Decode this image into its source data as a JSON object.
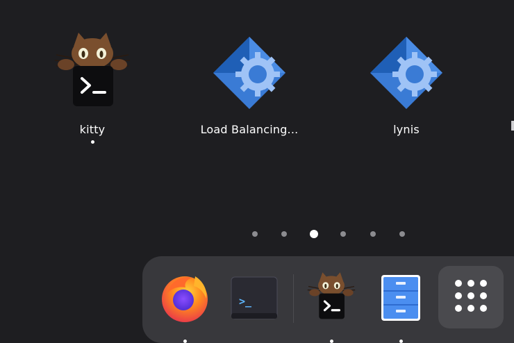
{
  "grid": {
    "apps": [
      {
        "label": "kitty",
        "icon": "kitty-cat-terminal-icon",
        "running": true
      },
      {
        "label": "Load Balancing...",
        "icon": "gear-diamond-icon",
        "running": false
      },
      {
        "label": "lynis",
        "icon": "gear-diamond-icon",
        "running": false
      }
    ]
  },
  "pager": {
    "pages": 6,
    "current_page": 3
  },
  "dock": {
    "items": [
      {
        "name": "firefox",
        "icon": "firefox-icon",
        "running": true
      },
      {
        "name": "terminal",
        "icon": "terminal-icon",
        "running": false
      },
      {
        "name": "kitty",
        "icon": "kitty-cat-terminal-icon",
        "running": true
      },
      {
        "name": "file-cabinet",
        "icon": "file-cabinet-icon",
        "running": true
      }
    ],
    "show_apps_icon": "app-grid-icon"
  },
  "terminal_prompt": ">_",
  "colors": {
    "background": "#1e1e21",
    "dock_background": "#38383c",
    "gear_blue": "#3a7bd5",
    "gear_dark_blue": "#1f5fb6",
    "cabinet_blue": "#4b8ef0",
    "cat_brown": "#7a4f2e"
  }
}
